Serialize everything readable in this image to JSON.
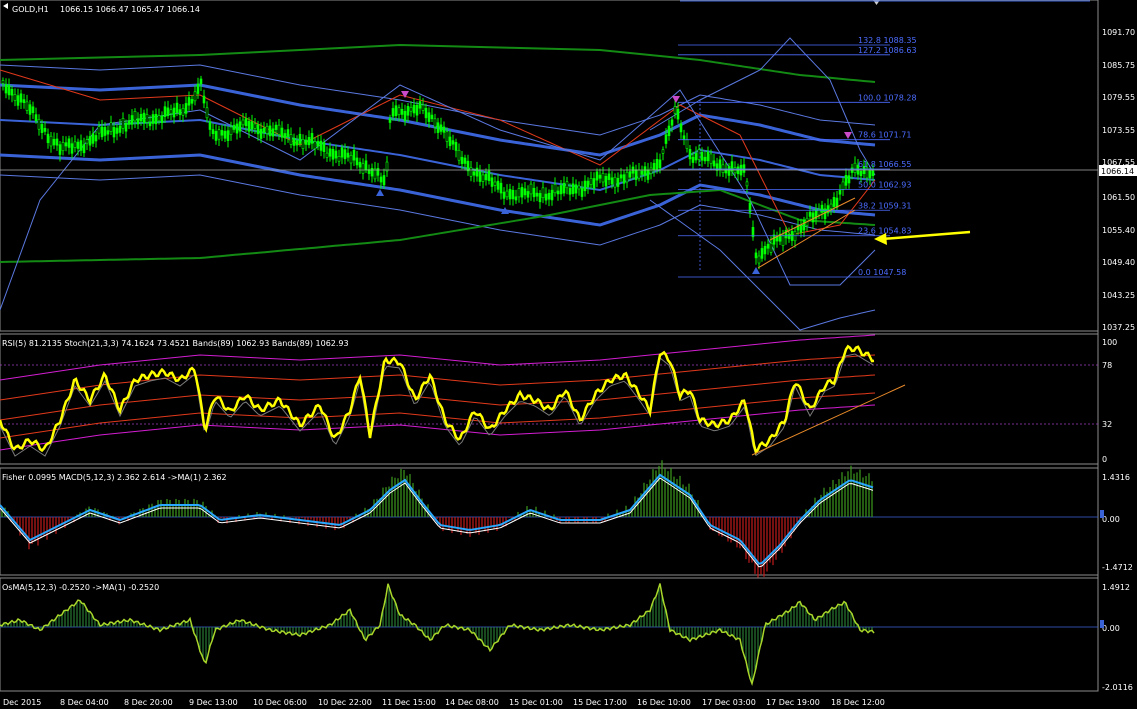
{
  "window": {
    "symbol": "GOLD,H1",
    "ohlc": "1066.15 1066.47 1065.47 1066.14"
  },
  "colors": {
    "background": "#000000",
    "grid_border": "#8c8c8c",
    "bull_candle": "#00ff00",
    "main_band": "#3a63d8",
    "outer_band": "#5a78e0",
    "green_ma": "#138a13",
    "red_ma": "#e0391b",
    "rsi": "#ffff00",
    "stoch": "#7a7a7a",
    "bands_magenta": "#d21ed2",
    "fisher_hist": "#3c9b1f",
    "fisher_hist_neg": "#c21b1b",
    "macd_line": "#2aa7ff",
    "osma_line": "#a9d62a",
    "fib": "#4c6cff",
    "arrow": "#ffff00"
  },
  "main": {
    "price_axis": [
      "1091.70",
      "1085.75",
      "1079.55",
      "1073.55",
      "1067.55",
      "1061.50",
      "1055.40",
      "1049.40",
      "1043.25",
      "1037.25"
    ],
    "current_price": "1066.14",
    "fib_levels": [
      {
        "label": "132.8 1088.35",
        "price": 1088.35
      },
      {
        "label": "127.2 1086.63",
        "price": 1086.63
      },
      {
        "label": "100.0 1078.28",
        "price": 1078.28
      },
      {
        "label": "78.6 1071.71",
        "price": 1071.71
      },
      {
        "label": "61.8 1066.55",
        "price": 1066.55
      },
      {
        "label": "50.0 1062.93",
        "price": 1062.93
      },
      {
        "label": "38.2 1059.31",
        "price": 1059.31
      },
      {
        "label": "23.6 1054.83",
        "price": 1054.83
      },
      {
        "label": "0.0 1047.58",
        "price": 1047.58
      }
    ]
  },
  "rsi_panel": {
    "header": "RSI(5) 81.2135  Stoch(21,3,3) 74.1624 73.4521  Bands(89) 1062.93  Bands(89) 1062.93",
    "axis": [
      "100",
      "78",
      "32",
      "0"
    ]
  },
  "fisher_panel": {
    "header": "Fisher 0.0995  MACD(5,12,3) 2.362 2.614  ->MA(1) 2.362",
    "axis": [
      "1.4316",
      "0.00",
      "-1.4712"
    ]
  },
  "osma_panel": {
    "header": "OsMA(5,12,3) -0.2520  ->MA(1) -0.2520",
    "axis": [
      "1.4912",
      "0.00",
      "-2.0116"
    ]
  },
  "time_axis": [
    "Dec 2015",
    "8 Dec 04:00",
    "8 Dec 20:00",
    "9 Dec 13:00",
    "10 Dec 06:00",
    "10 Dec 22:00",
    "11 Dec 15:00",
    "14 Dec 08:00",
    "15 Dec 01:00",
    "15 Dec 17:00",
    "16 Dec 10:00",
    "17 Dec 03:00",
    "17 Dec 19:00",
    "18 Dec 12:00"
  ]
}
